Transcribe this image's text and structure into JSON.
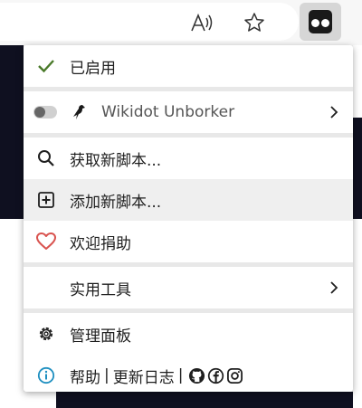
{
  "toolbar": {
    "read_aloud_icon": "read-aloud-icon",
    "favorite_icon": "star-icon",
    "extension_icon": "tampermonkey-icon"
  },
  "menu": {
    "enabled_label": "已启用",
    "script": {
      "name": "Wikidot Unborker",
      "enabled": false
    },
    "find_scripts": "获取新脚本...",
    "add_script": "添加新脚本...",
    "donate": "欢迎捐助",
    "utilities": "实用工具",
    "dashboard": "管理面板",
    "footer": {
      "help": "帮助",
      "sep1": "|",
      "changelog": "更新日志",
      "sep2": "|"
    }
  },
  "colors": {
    "check": "#4a7a2a",
    "heart": "#d9534f",
    "info": "#1e8fc0",
    "ext_button_bg": "#d6d6d6",
    "hover_bg": "#efefef"
  }
}
